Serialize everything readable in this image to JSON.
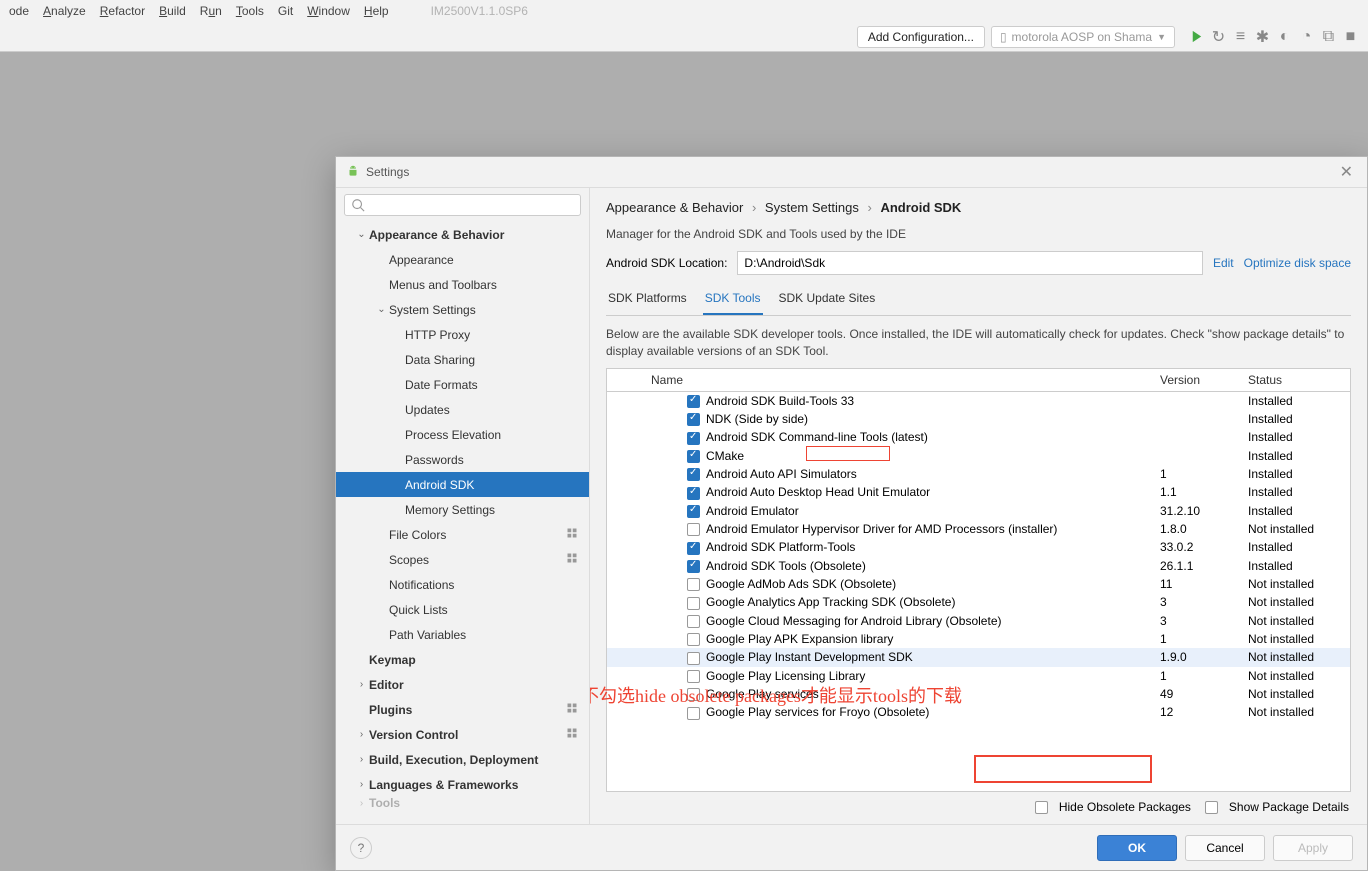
{
  "menubar": {
    "items": [
      "ode",
      "Analyze",
      "Refactor",
      "Build",
      "Run",
      "Tools",
      "Git",
      "Window",
      "Help"
    ],
    "underline": [
      -1,
      0,
      0,
      0,
      1,
      0,
      -1,
      0,
      0
    ],
    "title": "IM2500V1.1.0SP6"
  },
  "toolbar": {
    "add_config": "Add Configuration...",
    "device": "motorola AOSP on Shama"
  },
  "dialog": {
    "title": "Settings",
    "search_placeholder": "",
    "tree": [
      {
        "ind": 1,
        "chv": "v",
        "label": "Appearance & Behavior",
        "bold": true
      },
      {
        "ind": 2,
        "chv": "",
        "label": "Appearance"
      },
      {
        "ind": 2,
        "chv": "",
        "label": "Menus and Toolbars"
      },
      {
        "ind": 2,
        "chv": "v",
        "label": "System Settings"
      },
      {
        "ind": 3,
        "chv": "",
        "label": "HTTP Proxy"
      },
      {
        "ind": 3,
        "chv": "",
        "label": "Data Sharing"
      },
      {
        "ind": 3,
        "chv": "",
        "label": "Date Formats"
      },
      {
        "ind": 3,
        "chv": "",
        "label": "Updates"
      },
      {
        "ind": 3,
        "chv": "",
        "label": "Process Elevation"
      },
      {
        "ind": 3,
        "chv": "",
        "label": "Passwords"
      },
      {
        "ind": 3,
        "chv": "",
        "label": "Android SDK",
        "sel": true
      },
      {
        "ind": 3,
        "chv": "",
        "label": "Memory Settings"
      },
      {
        "ind": 2,
        "chv": "",
        "label": "File Colors",
        "gear": true
      },
      {
        "ind": 2,
        "chv": "",
        "label": "Scopes",
        "gear": true
      },
      {
        "ind": 2,
        "chv": "",
        "label": "Notifications"
      },
      {
        "ind": 2,
        "chv": "",
        "label": "Quick Lists"
      },
      {
        "ind": 2,
        "chv": "",
        "label": "Path Variables"
      },
      {
        "ind": 1,
        "chv": "",
        "label": "Keymap",
        "bold": true
      },
      {
        "ind": 1,
        "chv": ">",
        "label": "Editor",
        "bold": true
      },
      {
        "ind": 1,
        "chv": "",
        "label": "Plugins",
        "bold": true,
        "gear": true
      },
      {
        "ind": 1,
        "chv": ">",
        "label": "Version Control",
        "bold": true,
        "gear": true
      },
      {
        "ind": 1,
        "chv": ">",
        "label": "Build, Execution, Deployment",
        "bold": true
      },
      {
        "ind": 1,
        "chv": ">",
        "label": "Languages & Frameworks",
        "bold": true
      },
      {
        "ind": 1,
        "chv": ">",
        "label": "Tools",
        "bold": true,
        "cut": true
      }
    ],
    "breadcrumb": [
      "Appearance & Behavior",
      "System Settings",
      "Android SDK"
    ],
    "desc": "Manager for the Android SDK and Tools used by the IDE",
    "loc_label": "Android SDK Location:",
    "loc_value": "D:\\Android\\Sdk",
    "edit": "Edit",
    "optimize": "Optimize disk space",
    "tabs": [
      "SDK Platforms",
      "SDK Tools",
      "SDK Update Sites"
    ],
    "active_tab": 1,
    "subdesc": "Below are the available SDK developer tools. Once installed, the IDE will automatically check for updates. Check \"show package details\" to display available versions of an SDK Tool.",
    "cols": [
      "Name",
      "Version",
      "Status"
    ],
    "rows": [
      {
        "ck": true,
        "name": "Android SDK Build-Tools 33",
        "ver": "",
        "stat": "Installed"
      },
      {
        "ck": true,
        "name": "NDK (Side by side)",
        "ver": "",
        "stat": "Installed"
      },
      {
        "ck": true,
        "name": "Android SDK Command-line Tools (latest)",
        "ver": "",
        "stat": "Installed"
      },
      {
        "ck": true,
        "name": "CMake",
        "ver": "",
        "stat": "Installed"
      },
      {
        "ck": true,
        "name": "Android Auto API Simulators",
        "ver": "1",
        "stat": "Installed"
      },
      {
        "ck": true,
        "name": "Android Auto Desktop Head Unit Emulator",
        "ver": "1.1",
        "stat": "Installed"
      },
      {
        "ck": true,
        "name": "Android Emulator",
        "ver": "31.2.10",
        "stat": "Installed"
      },
      {
        "ck": false,
        "name": "Android Emulator Hypervisor Driver for AMD Processors (installer)",
        "ver": "1.8.0",
        "stat": "Not installed"
      },
      {
        "ck": true,
        "name": "Android SDK Platform-Tools",
        "ver": "33.0.2",
        "stat": "Installed"
      },
      {
        "ck": true,
        "name": "Android SDK Tools (Obsolete)",
        "ver": "26.1.1",
        "stat": "Installed"
      },
      {
        "ck": false,
        "name": "Google AdMob Ads SDK (Obsolete)",
        "ver": "11",
        "stat": "Not installed"
      },
      {
        "ck": false,
        "name": "Google Analytics App Tracking SDK (Obsolete)",
        "ver": "3",
        "stat": "Not installed"
      },
      {
        "ck": false,
        "name": "Google Cloud Messaging for Android Library (Obsolete)",
        "ver": "3",
        "stat": "Not installed"
      },
      {
        "ck": false,
        "name": "Google Play APK Expansion library",
        "ver": "1",
        "stat": "Not installed"
      },
      {
        "ck": false,
        "name": "Google Play Instant Development SDK",
        "ver": "1.9.0",
        "stat": "Not installed",
        "hl": true
      },
      {
        "ck": false,
        "name": "Google Play Licensing Library",
        "ver": "1",
        "stat": "Not installed"
      },
      {
        "ck": false,
        "name": "Google Play services",
        "ver": "49",
        "stat": "Not installed"
      },
      {
        "ck": false,
        "name": "Google Play services for Froyo (Obsolete)",
        "ver": "12",
        "stat": "Not installed"
      }
    ],
    "hide_obsolete": "Hide Obsolete Packages",
    "show_details": "Show Package Details",
    "ok": "OK",
    "cancel": "Cancel",
    "apply": "Apply"
  },
  "annotations": {
    "red_text": "不勾选hide obsolete packages才能显示tools的下载"
  }
}
